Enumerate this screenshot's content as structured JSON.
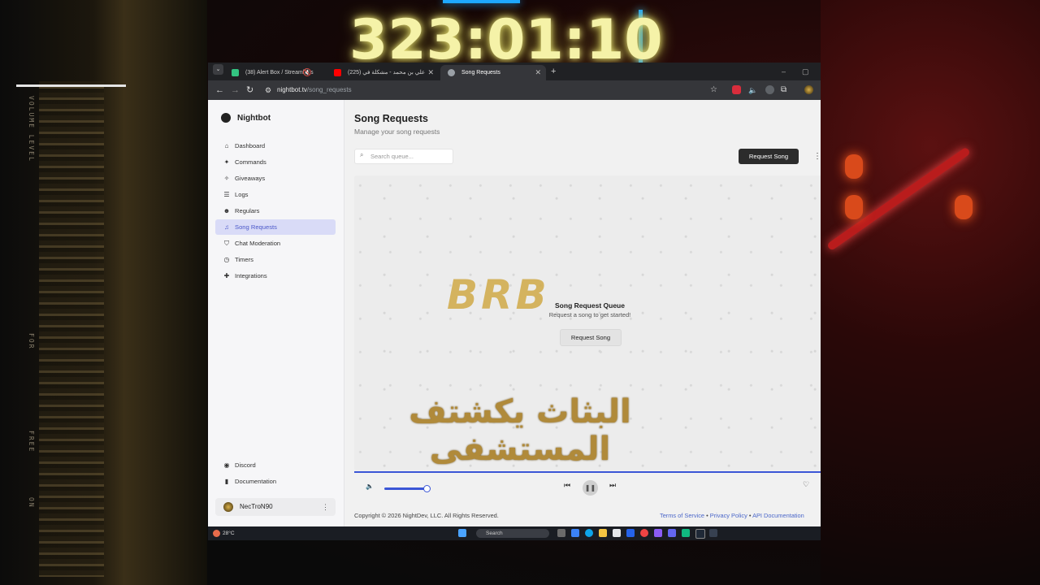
{
  "overlay": {
    "timer": "323:01:10",
    "side_labels": [
      "VOLUME LEVEL",
      "FOR",
      "FREE",
      "ON"
    ],
    "brb_logo": "BRB",
    "caption_ar": "البثاث يكشتف المستشفى"
  },
  "browser": {
    "tabs": [
      {
        "title": "(38) Alert Box / Streamlabs",
        "active": false
      },
      {
        "title": "(225) علي بن محمد - مشكلة في",
        "active": false
      },
      {
        "title": "Song Requests",
        "active": true
      }
    ],
    "new_tab": "+",
    "url_host": "nightbot.tv",
    "url_path": "/song_requests"
  },
  "app": {
    "brand": "Nightbot",
    "sidebar": {
      "items": [
        {
          "label": "Dashboard",
          "icon": "home-icon",
          "active": false
        },
        {
          "label": "Commands",
          "icon": "wand-icon",
          "active": false
        },
        {
          "label": "Giveaways",
          "icon": "gift-icon",
          "active": false
        },
        {
          "label": "Logs",
          "icon": "list-icon",
          "active": false
        },
        {
          "label": "Regulars",
          "icon": "users-icon",
          "active": false
        },
        {
          "label": "Song Requests",
          "icon": "headphones-icon",
          "active": true
        },
        {
          "label": "Chat Moderation",
          "icon": "shield-icon",
          "active": false
        },
        {
          "label": "Timers",
          "icon": "clock-icon",
          "active": false
        },
        {
          "label": "Integrations",
          "icon": "puzzle-icon",
          "active": false
        }
      ],
      "bottom_items": [
        {
          "label": "Discord",
          "icon": "discord-icon"
        },
        {
          "label": "Documentation",
          "icon": "book-icon"
        }
      ],
      "user": {
        "name": "NecTroN90"
      }
    },
    "main": {
      "title": "Song Requests",
      "subtitle": "Manage your song requests",
      "search_placeholder": "Search queue...",
      "request_button": "Request Song",
      "empty_title": "Song Request Queue",
      "empty_subtitle": "Request a song to get started!",
      "empty_button": "Request Song"
    },
    "player": {
      "volume": 0.95
    },
    "footer": {
      "copyright": "Copyright © 2026 NightDev, LLC. All Rights Reserved.",
      "links": [
        "Terms of Service",
        "Privacy Policy",
        "API Documentation"
      ],
      "separator": "•"
    }
  },
  "taskbar": {
    "weather": "28°C",
    "search": "Search"
  },
  "colors": {
    "accent": "#3b56d6",
    "active_nav_bg": "#d9dbf7",
    "timer_glow": "#f5f2a8",
    "neon_blue": "#1ea8ff"
  }
}
